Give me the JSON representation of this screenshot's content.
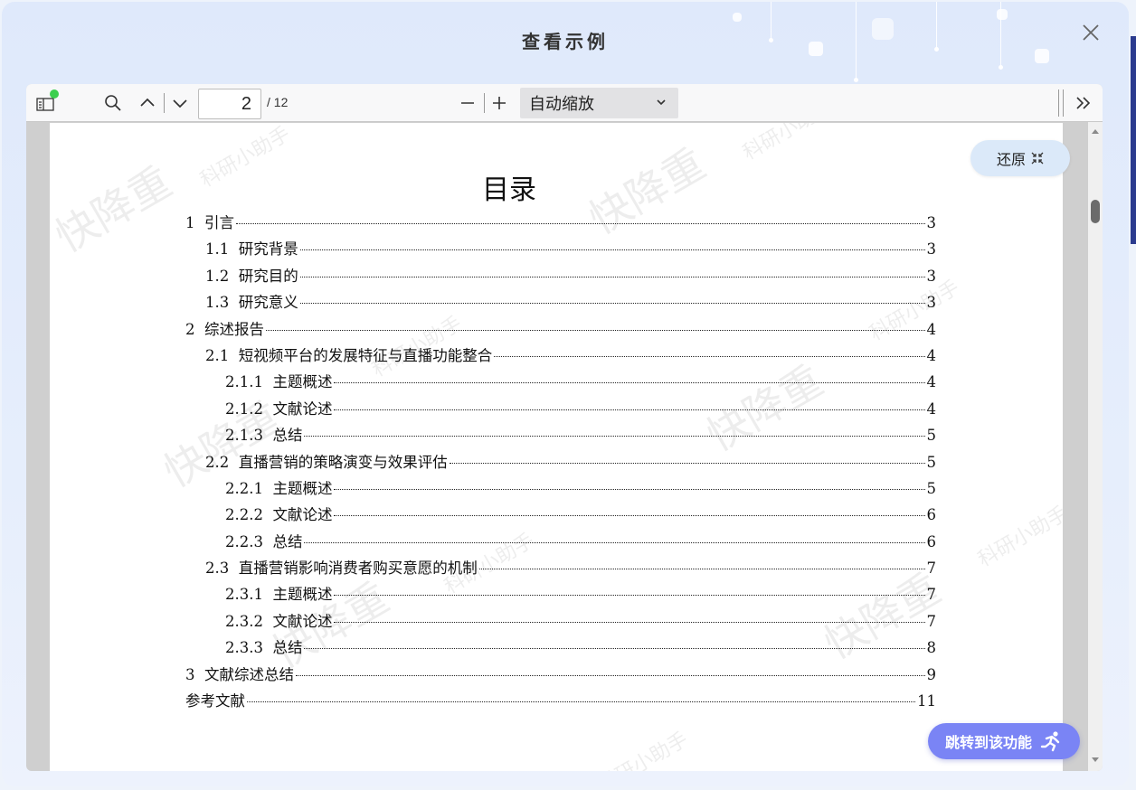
{
  "modal": {
    "title": "查看示例"
  },
  "toolbar": {
    "current_page": "2",
    "total_pages": "/ 12",
    "zoom": "自动缩放"
  },
  "document": {
    "title": "目录",
    "entries": [
      {
        "num": "1  ",
        "label": "引言",
        "page": "3",
        "level": 0
      },
      {
        "num": "1.1  ",
        "label": "研究背景",
        "page": "3",
        "level": 1
      },
      {
        "num": "1.2  ",
        "label": "研究目的",
        "page": "3",
        "level": 1
      },
      {
        "num": "1.3  ",
        "label": "研究意义",
        "page": "3",
        "level": 1
      },
      {
        "num": "2  ",
        "label": "综述报告",
        "page": "4",
        "level": 0
      },
      {
        "num": "2.1  ",
        "label": "短视频平台的发展特征与直播功能整合",
        "page": "4",
        "level": 1
      },
      {
        "num": "2.1.1  ",
        "label": "主题概述",
        "page": "4",
        "level": 2
      },
      {
        "num": "2.1.2  ",
        "label": "文献论述",
        "page": "4",
        "level": 2
      },
      {
        "num": "2.1.3  ",
        "label": "总结",
        "page": "5",
        "level": 2
      },
      {
        "num": "2.2  ",
        "label": "直播营销的策略演变与效果评估",
        "page": "5",
        "level": 1
      },
      {
        "num": "2.2.1  ",
        "label": "主题概述",
        "page": "5",
        "level": 2
      },
      {
        "num": "2.2.2  ",
        "label": "文献论述",
        "page": "6",
        "level": 2
      },
      {
        "num": "2.2.3  ",
        "label": "总结",
        "page": "6",
        "level": 2
      },
      {
        "num": "2.3  ",
        "label": "直播营销影响消费者购买意愿的机制",
        "page": "7",
        "level": 1
      },
      {
        "num": "2.3.1  ",
        "label": "主题概述",
        "page": "7",
        "level": 2
      },
      {
        "num": "2.3.2  ",
        "label": "文献论述",
        "page": "7",
        "level": 2
      },
      {
        "num": "2.3.3  ",
        "label": "总结",
        "page": "8",
        "level": 2
      },
      {
        "num": "3  ",
        "label": "文献综述总结",
        "page": "9",
        "level": 0
      },
      {
        "num": "",
        "label": "参考文献",
        "page": "11",
        "level": 0
      }
    ],
    "watermark_large": "快降重",
    "watermark_small": "科研小助手"
  },
  "buttons": {
    "restore": "还原",
    "jump": "跳转到该功能"
  },
  "colors": {
    "accent": "#7a84f5",
    "badge": "#3ccf4e"
  }
}
